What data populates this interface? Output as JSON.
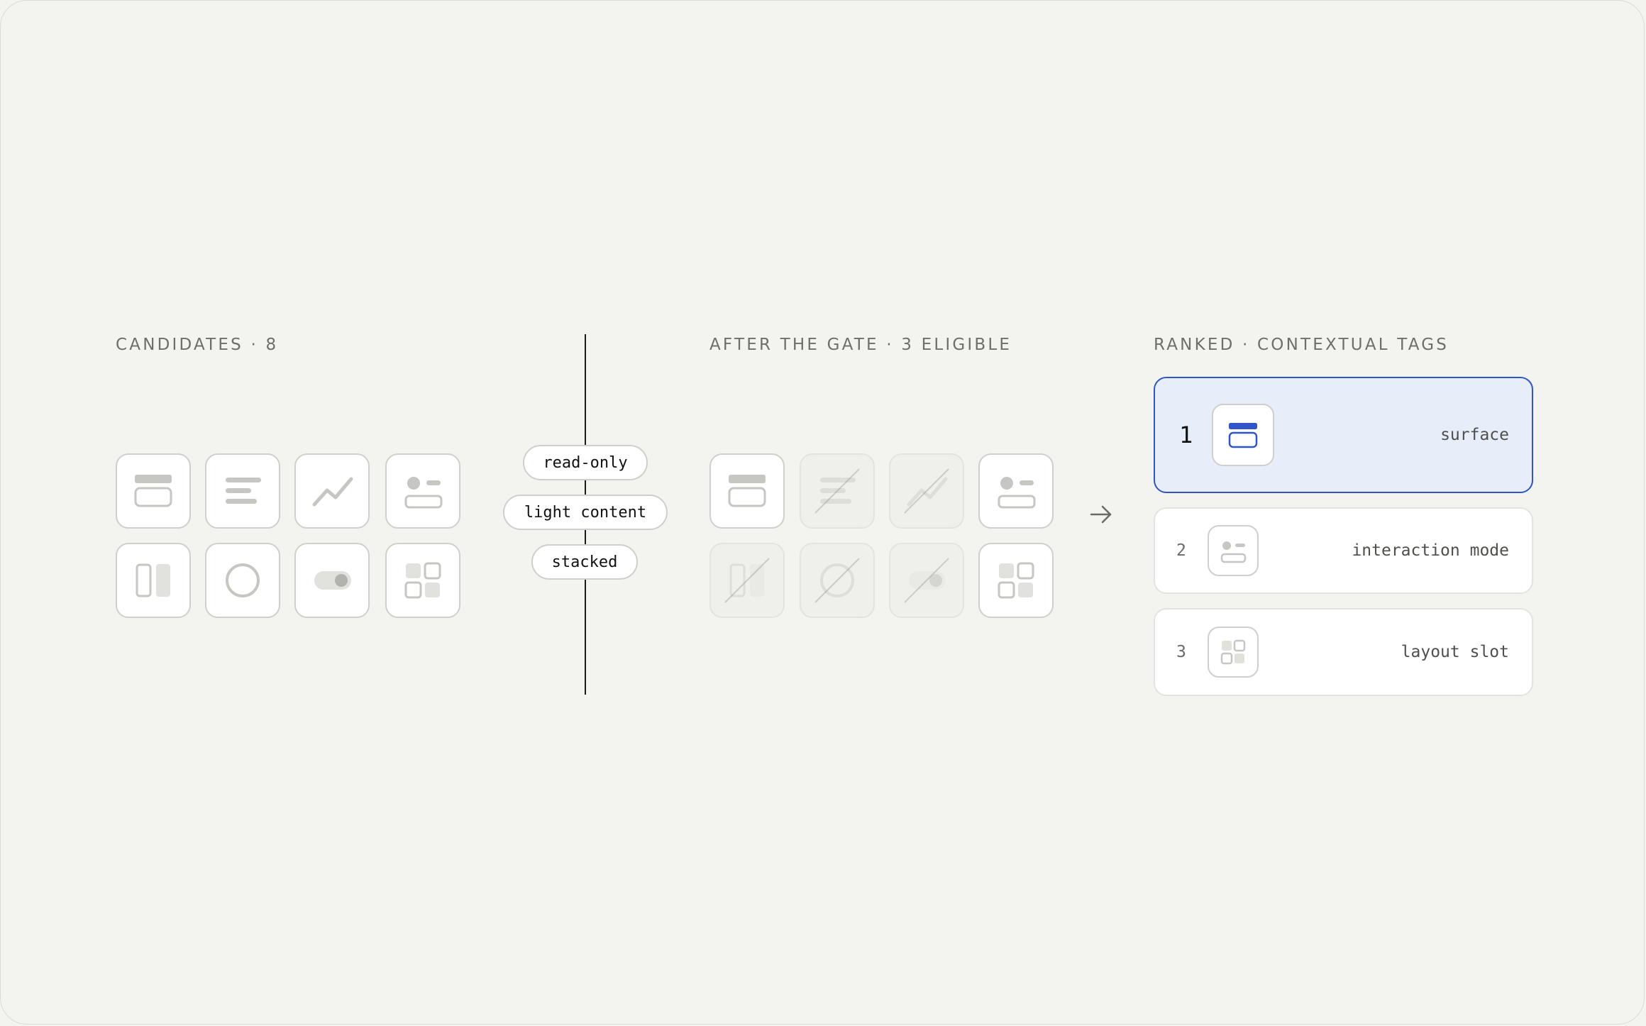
{
  "labels": {
    "candidates": "CANDIDATES · 8",
    "after_gate": "AFTER THE GATE · 3 ELIGIBLE",
    "ranked": "RANKED · CONTEXTUAL TAGS"
  },
  "candidates": [
    {
      "icon": "card-icon"
    },
    {
      "icon": "text-lines-icon"
    },
    {
      "icon": "line-chart-icon"
    },
    {
      "icon": "profile-row-icon"
    },
    {
      "icon": "split-panel-icon"
    },
    {
      "icon": "circle-icon"
    },
    {
      "icon": "toggle-icon"
    },
    {
      "icon": "grid-icon"
    }
  ],
  "gate": {
    "constraints": [
      "read-only",
      "light content",
      "stacked"
    ]
  },
  "after_gate": [
    {
      "icon": "card-icon",
      "eligible": true
    },
    {
      "icon": "text-lines-icon",
      "eligible": false
    },
    {
      "icon": "line-chart-icon",
      "eligible": false
    },
    {
      "icon": "profile-row-icon",
      "eligible": true
    },
    {
      "icon": "split-panel-icon",
      "eligible": false
    },
    {
      "icon": "circle-icon",
      "eligible": false
    },
    {
      "icon": "toggle-icon",
      "eligible": false
    },
    {
      "icon": "grid-icon",
      "eligible": true
    }
  ],
  "ranked": [
    {
      "rank": "1",
      "icon": "card-icon",
      "tag": "surface",
      "highlighted": true
    },
    {
      "rank": "2",
      "icon": "profile-row-icon",
      "tag": "interaction mode",
      "highlighted": false
    },
    {
      "rank": "3",
      "icon": "grid-icon",
      "tag": "layout slot",
      "highlighted": false
    }
  ],
  "colors": {
    "background": "#f3f3ef",
    "accent": "#2f55c9",
    "highlight_fill": "#e8edfa",
    "icon_gray": "#c6c6c3"
  }
}
